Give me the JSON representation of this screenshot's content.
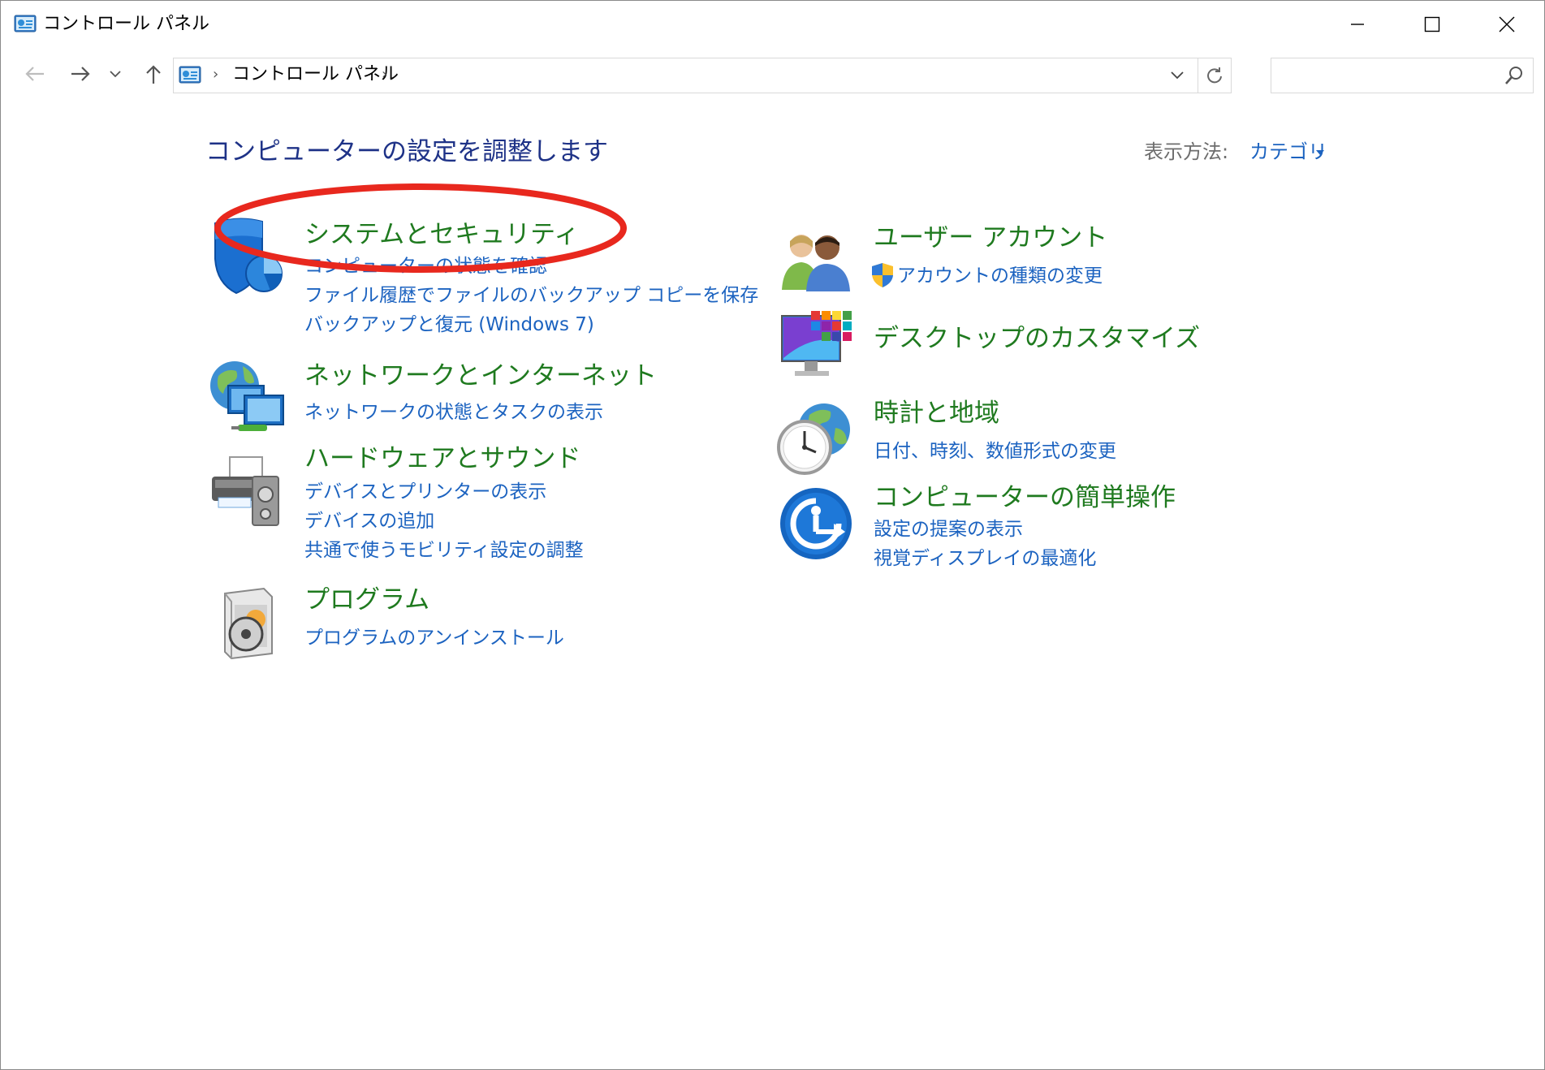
{
  "window": {
    "title": "コントロール パネル",
    "icon": "control-panel-icon"
  },
  "address_bar": {
    "path": "コントロール パネル",
    "search_placeholder": ""
  },
  "content": {
    "heading": "コンピューターの設定を調整します",
    "view_by_label": "表示方法:",
    "view_by_value": "カテゴリ"
  },
  "categories": {
    "system_security": {
      "title": "システムとセキュリティ",
      "links": [
        "コンピューターの状態を確認",
        "ファイル履歴でファイルのバックアップ コピーを保存",
        "バックアップと復元 (Windows 7)"
      ]
    },
    "network": {
      "title": "ネットワークとインターネット",
      "links": [
        "ネットワークの状態とタスクの表示"
      ]
    },
    "hardware": {
      "title": "ハードウェアとサウンド",
      "links": [
        "デバイスとプリンターの表示",
        "デバイスの追加",
        "共通で使うモビリティ設定の調整"
      ]
    },
    "programs": {
      "title": "プログラム",
      "links": [
        "プログラムのアンインストール"
      ]
    },
    "user_accounts": {
      "title": "ユーザー アカウント",
      "links": [
        "アカウントの種類の変更"
      ]
    },
    "appearance": {
      "title": "デスクトップのカスタマイズ",
      "links": []
    },
    "clock_region": {
      "title": "時計と地域",
      "links": [
        "日付、時刻、数値形式の変更"
      ]
    },
    "ease_of_access": {
      "title": "コンピューターの簡単操作",
      "links": [
        "設定の提案の表示",
        "視覚ディスプレイの最適化"
      ]
    }
  },
  "colors": {
    "heading": "#1e3287",
    "category_title": "#1f7a1f",
    "link": "#1c63c0",
    "highlight": "#e8281e"
  }
}
